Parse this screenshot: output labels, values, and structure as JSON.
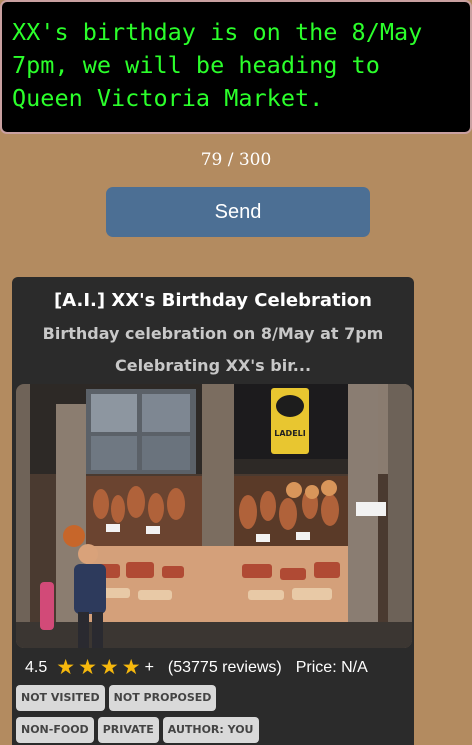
{
  "message_box": {
    "text": "XX's birthday is on the 8/May\n7pm, we will be heading to\nQueen Victoria Market."
  },
  "counter": {
    "text": "79 / 300"
  },
  "send_button": {
    "label": "Send"
  },
  "card": {
    "title": "[A.I.] XX's Birthday Celebration",
    "subtitle": "Birthday celebration on 8/May at 7pm",
    "description": "Celebrating XX's bir...",
    "photo_sign": "LADELI",
    "rating_value": "4.5",
    "stars_count": 4,
    "stars_suffix": "+",
    "reviews": "(53775 reviews)",
    "price": "Price: N/A",
    "tags_row1": [
      "NOT VISITED",
      "NOT PROPOSED"
    ],
    "tags_row2": [
      "NON-FOOD",
      "PRIVATE",
      "AUTHOR: YOU"
    ]
  },
  "colors": {
    "background": "#b38b60",
    "terminal_text": "#2bff2b",
    "send_button": "#4c6f94",
    "card_bg": "#2b2b2b",
    "star": "#f6b80d"
  }
}
